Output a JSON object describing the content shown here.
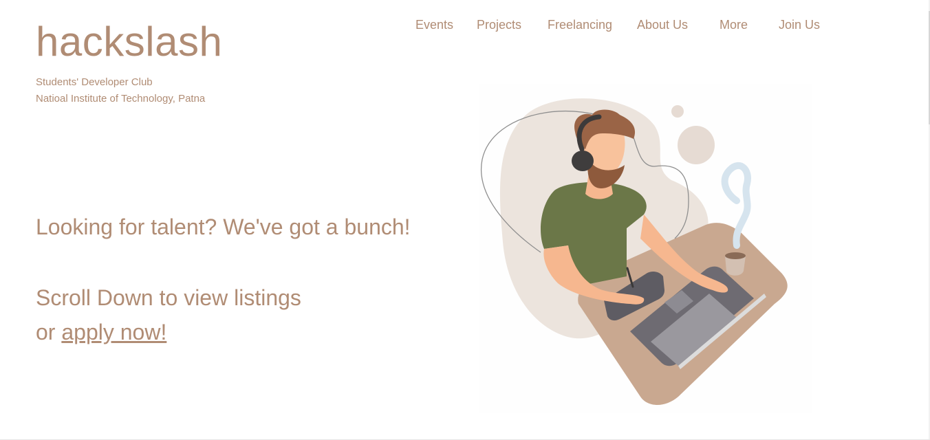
{
  "brand": {
    "title": "hackslash",
    "subtitle_line1": "Students' Developer Club",
    "subtitle_line2": "Natioal Institute of Technology, Patna"
  },
  "nav": {
    "items": [
      {
        "label": "Events"
      },
      {
        "label": "Projects"
      },
      {
        "label": "Freelancing"
      },
      {
        "label": "About Us"
      },
      {
        "label": "More"
      },
      {
        "label": "Join Us"
      }
    ]
  },
  "hero": {
    "headline": "Looking for talent? We've got a bunch!",
    "scroll_text": "Scroll Down to view listings",
    "or_text": "or ",
    "apply_link": "apply now!"
  },
  "illustration": {
    "icon": "developer-at-laptop-illustration"
  },
  "colors": {
    "text": "#b08c74",
    "background": "#ffffff",
    "shirt": "#6b7748",
    "skin": "#f6b78f",
    "desk": "#c7a58c",
    "laptop": "#6e6b72"
  }
}
